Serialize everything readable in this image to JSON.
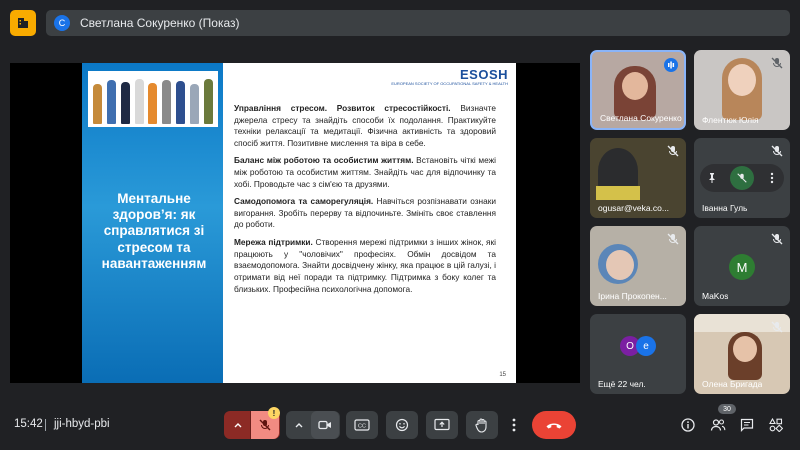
{
  "header": {
    "presenter_initial": "С",
    "presenter_label": "Светлана Сокуренко (Показ)"
  },
  "slide": {
    "logo": "ESOSH",
    "logo_sub": "EUROPEAN SOCIETY OF OCCUPATIONAL SAFETY & HEALTH",
    "title": "Ментальне здоров’я: як справлятися зі стресом та навантаженням",
    "paragraphs": [
      {
        "heading": "Управління стресом. Розвиток стресостійкості.",
        "body": " Визначте джерела стресу та знайдіть способи їх подолання. Практикуйте техніки релаксації та медитації. Фізична активність та здоровий спосіб життя. Позитивне мислення та віра в себе."
      },
      {
        "heading": "Баланс між роботою та особистим життям.",
        "body": " Встановіть чіткі межі між роботою та особистим життям. Знайдіть час для відпочинку та хобі. Проводьте час з сім'єю та друзями."
      },
      {
        "heading": "Самодопомога та саморегуляція.",
        "body": " Навчіться розпізнавати ознаки вигорання. Зробіть перерву та відпочиньте. Змініть своє ставлення до роботи."
      },
      {
        "heading": "Мережа підтримки.",
        "body": " Створення мережі підтримки з інших жінок, які працюють у \"чоловічих\" професіях. Обмін досвідом та взаємодопомога. Знайти досвідчену жінку, яка працює в цій галузі, і отримати від неї поради та підтримку. Підтримка з боку колег та близьких. Професійна психологічна допомога."
      }
    ],
    "page_number": "15"
  },
  "participants": [
    {
      "name": "Светлана Сокуренко"
    },
    {
      "name": "Флентюк Юлія"
    },
    {
      "name": "ogusar@veka.co..."
    },
    {
      "name": "Іванна Гуль"
    },
    {
      "name": "Ірина Прокопен..."
    },
    {
      "name": "MaKos",
      "initial": "M"
    },
    {
      "name": "Ещё 22 чел.",
      "initials": [
        "O",
        "e"
      ]
    },
    {
      "name": "Олена Бригада"
    }
  ],
  "bottom_bar": {
    "time": "15:42",
    "meeting_code": "jji-hbyd-pbi",
    "participant_count": "30",
    "warning": "!"
  },
  "colors": {
    "background": "#202124",
    "hangup": "#ea4335",
    "mic_off": "#8c2a25",
    "accent": "#1a73e8"
  }
}
